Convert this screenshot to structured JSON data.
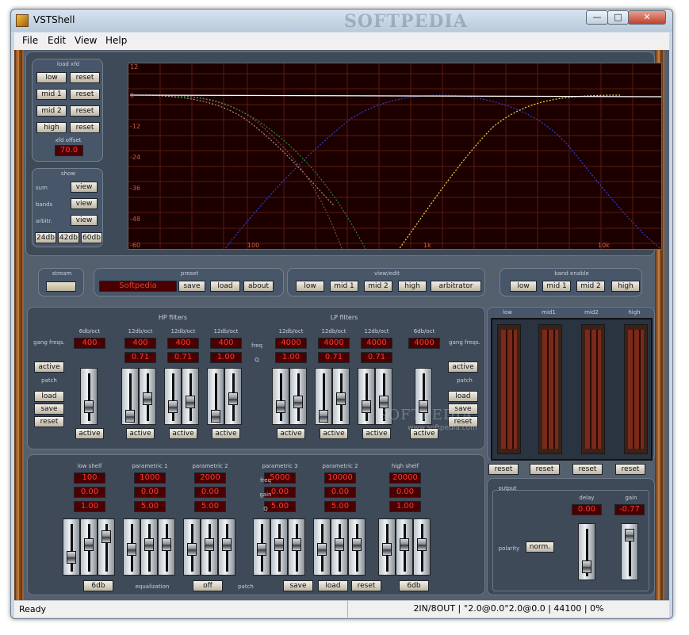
{
  "window": {
    "title": "VSTShell",
    "watermark": "SOFTPEDIA"
  },
  "menu": [
    "File",
    "Edit",
    "View",
    "Help"
  ],
  "xfd": {
    "title": "load xfd",
    "bands": [
      "low",
      "mid 1",
      "mid 2",
      "high"
    ],
    "reset": "reset",
    "offset_label": "xfd offset",
    "offset_value": "70.0"
  },
  "show": {
    "title": "show",
    "rows": [
      "sum",
      "bands",
      "arbitr."
    ],
    "view": "view",
    "ranges": [
      "24db",
      "42db",
      "60db"
    ]
  },
  "graph": {
    "y_ticks": [
      "12",
      "0",
      "-12",
      "-24",
      "-36",
      "-48",
      "-60"
    ],
    "x_ticks": [
      "20",
      "100",
      "1k",
      "10k"
    ]
  },
  "stream": {
    "title": "stream"
  },
  "preset": {
    "title": "preset",
    "name": "Softpedia",
    "buttons": [
      "save",
      "load",
      "about"
    ]
  },
  "viewedit": {
    "title": "view/edit",
    "buttons": [
      "low",
      "mid 1",
      "mid 2",
      "high",
      "arbitrator"
    ]
  },
  "bandenable": {
    "title": "band enable",
    "buttons": [
      "low",
      "mid 1",
      "mid 2",
      "high"
    ]
  },
  "hp": {
    "title": "HP filters",
    "slopes": [
      "6db/oct",
      "12db/oct",
      "12db/oct",
      "12db/oct"
    ],
    "freqs": [
      "400",
      "400",
      "400",
      "400"
    ],
    "qs": [
      "",
      "0.71",
      "0.71",
      "1.00"
    ],
    "active": "active"
  },
  "lp": {
    "title": "LP filters",
    "slopes": [
      "12db/oct",
      "12db/oct",
      "12db/oct",
      "6db/oct"
    ],
    "freqs": [
      "4000",
      "4000",
      "4000",
      "4000"
    ],
    "qs": [
      "1.00",
      "0.71",
      "0.71",
      ""
    ],
    "active": "active"
  },
  "gang": {
    "label": "gang freqs.",
    "active": "active",
    "patch": "patch",
    "load": "load",
    "save": "save",
    "reset": "reset"
  },
  "mid_labels": {
    "freq": "freq",
    "q": "Q",
    "gain": "gain"
  },
  "meters": {
    "labels": [
      "low",
      "mid1",
      "mid2",
      "high"
    ],
    "reset": "reset"
  },
  "eq": {
    "bands": [
      {
        "name": "low shelf",
        "freq": "100",
        "gain": "0.00",
        "q": "1.00"
      },
      {
        "name": "parametric 1",
        "freq": "1000",
        "gain": "0.00",
        "q": "5.00"
      },
      {
        "name": "parametric 2",
        "freq": "2000",
        "gain": "0.00",
        "q": "5.00"
      },
      {
        "name": "parametric 3",
        "freq": "5000",
        "gain": "0.00",
        "q": "5.00"
      },
      {
        "name": "parametric 2",
        "freq": "10000",
        "gain": "0.00",
        "q": "5.00"
      },
      {
        "name": "high shelf",
        "freq": "20000",
        "gain": "0.00",
        "q": "1.00"
      }
    ],
    "db_button": "6db",
    "equalization": "equalization",
    "off": "off",
    "patch": "patch",
    "save": "save",
    "load": "load",
    "reset": "reset"
  },
  "output": {
    "title": "output",
    "delay_label": "delay",
    "gain_label": "gain",
    "delay": "0.00",
    "gain": "-0.77",
    "polarity": "polarity",
    "norm": "norm."
  },
  "overlay_watermark": {
    "big": "SOFTPEDIA",
    "small": "www.softpedia.com"
  },
  "statusbar": {
    "left": "Ready",
    "right": "2IN/8OUT | °2.0@0.0°2.0@0.0 | 44100 | 0%"
  }
}
